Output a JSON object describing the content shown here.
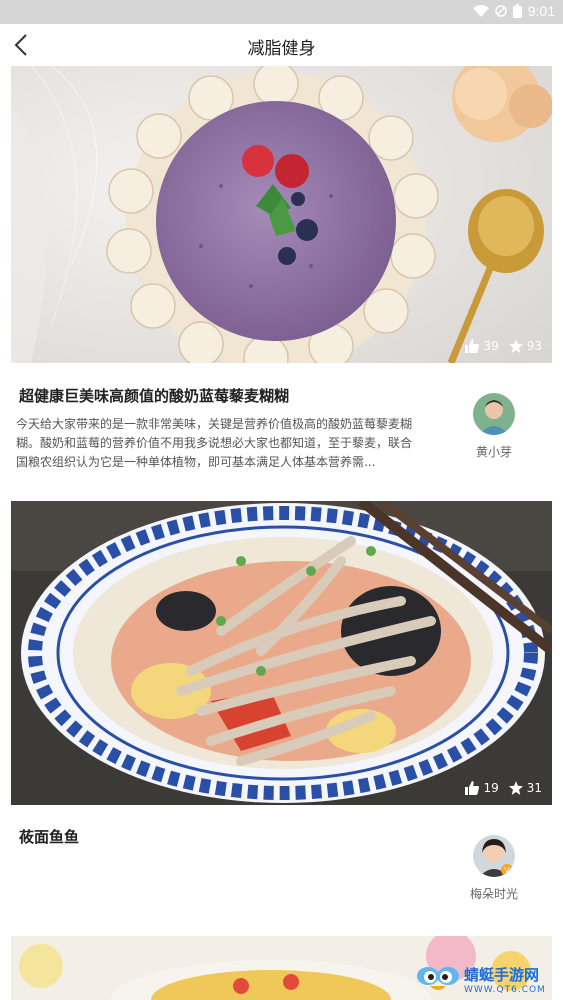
{
  "status_bar": {
    "time": "9:01"
  },
  "header": {
    "title": "减脂健身"
  },
  "cards": [
    {
      "title": "超健康巨美味高颜值的酸奶蓝莓藜麦糊糊",
      "description": "今天给大家带来的是一款非常美味，关键是营养价值极高的酸奶蓝莓藜麦糊糊。酸奶和蓝莓的营养价值不用我多说想必大家也都知道，至于藜麦，联合国粮农组织认为它是一种单体植物，即可基本满足人体基本营养需...",
      "likes": "39",
      "favorites": "93",
      "author": "黄小芽"
    },
    {
      "title": "莜面鱼鱼",
      "description": "",
      "likes": "19",
      "favorites": "31",
      "author": "梅朵时光"
    }
  ],
  "watermark": {
    "name": "蜻蜓手游网",
    "url": "WWW.QT6.COM"
  },
  "icons": {
    "back": "chevron-left-icon",
    "like": "thumbs-up-icon",
    "favorite": "star-icon"
  },
  "colors": {
    "accent": "#1d6fd6",
    "status_bar": "#d6d6d6"
  }
}
